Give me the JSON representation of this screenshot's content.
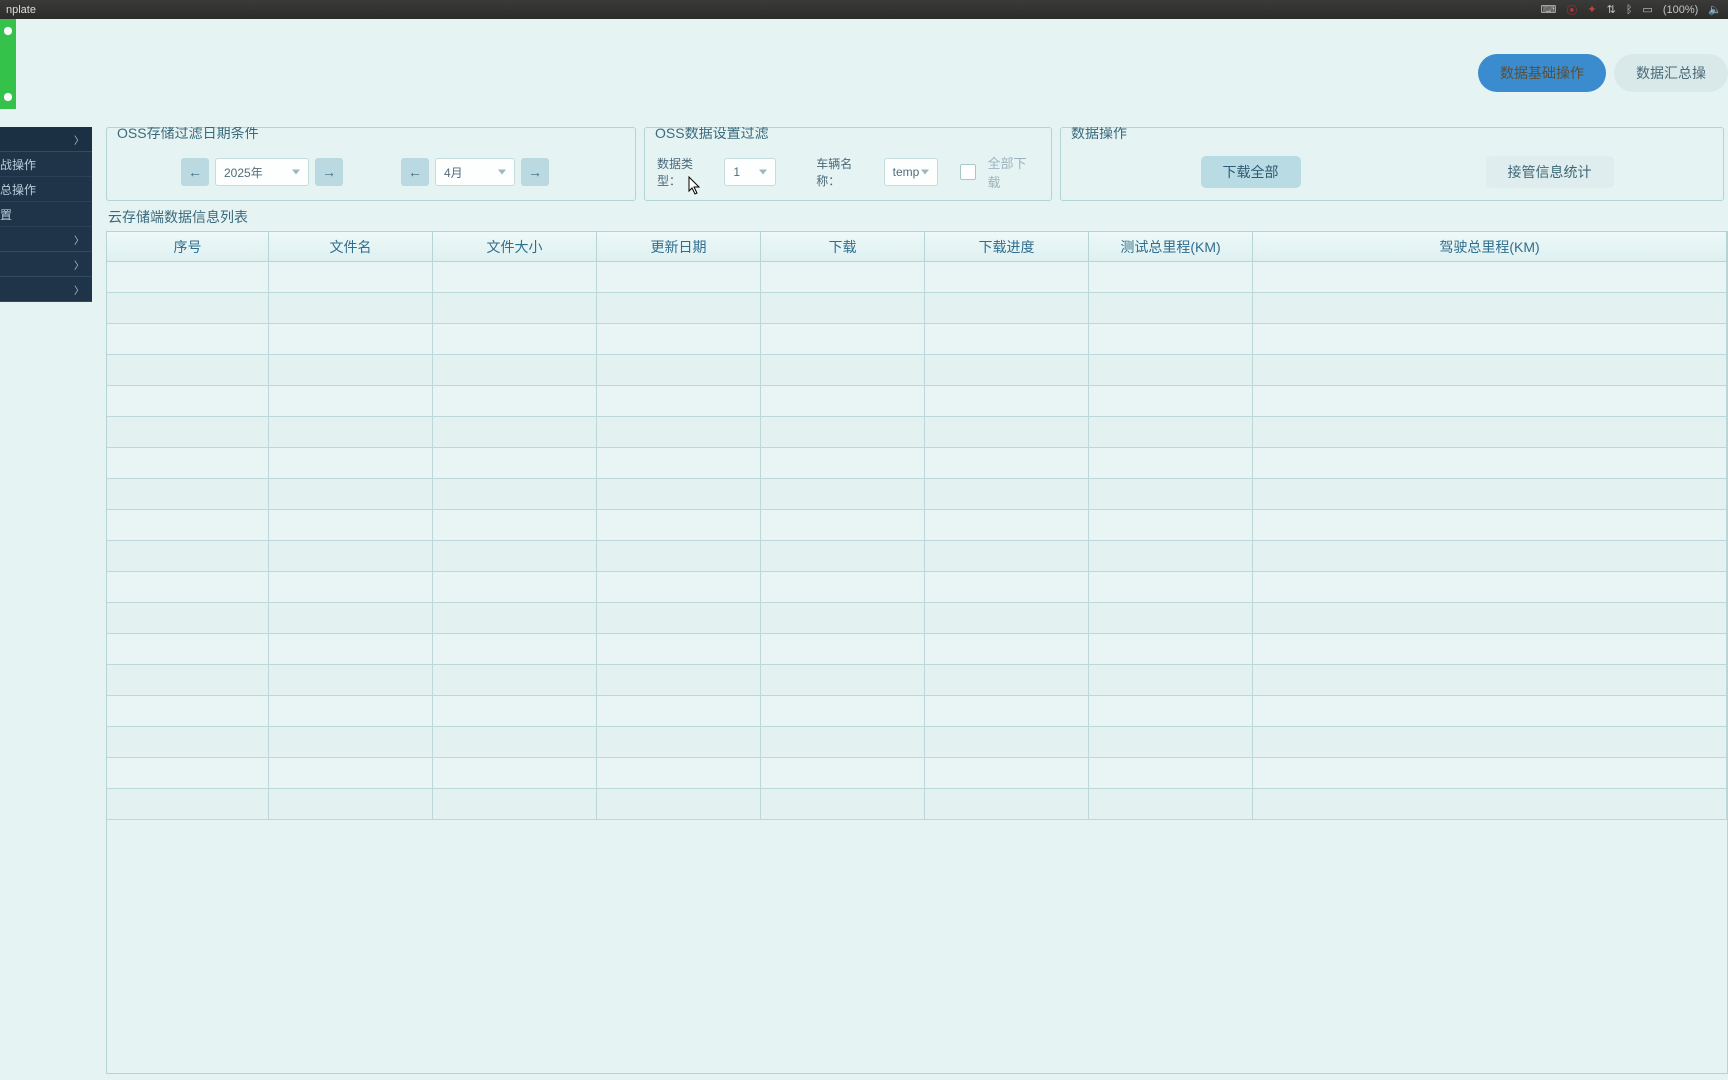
{
  "system_bar": {
    "title_fragment": "nplate",
    "battery": "(100%)"
  },
  "header_tabs": {
    "basic_ops": "数据基础操作",
    "summary_ops": "数据汇总操"
  },
  "sidebar": {
    "group_expanded_suffix": "",
    "sub1": "战操作",
    "sub2": "总操作",
    "sub3": "置"
  },
  "panels": {
    "date_filter_title": "OSS存储过滤日期条件",
    "data_filter_title": "OSS数据设置过滤",
    "ops_title": "数据操作",
    "year_value": "2025年",
    "month_value": "4月",
    "data_type_label": "数据类型：",
    "data_type_value": "1",
    "vehicle_label": "车辆名称：",
    "vehicle_value": "temp",
    "download_all_cb": "全部下载",
    "download_all_btn": "下载全部",
    "takeover_stats_btn": "接管信息统计"
  },
  "list_title": "云存储端数据信息列表",
  "table_headers": [
    "序号",
    "文件名",
    "文件大小",
    "更新日期",
    "下载",
    "下载进度",
    "测试总里程(KM)",
    "驾驶总里程(KM)"
  ],
  "row_count": 18
}
